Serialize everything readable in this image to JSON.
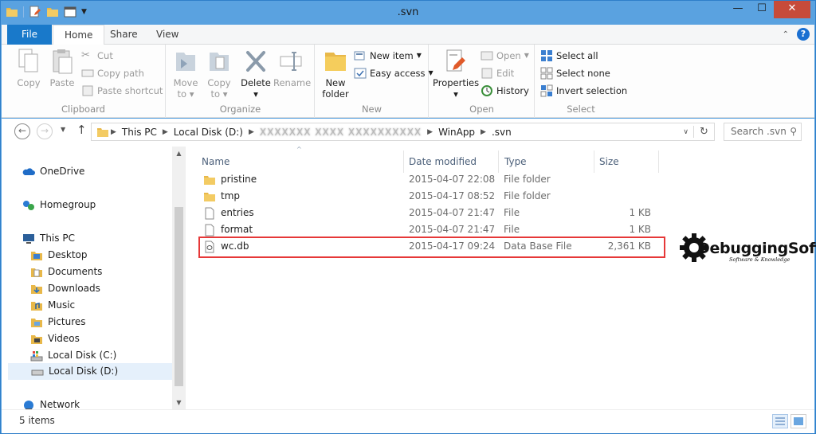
{
  "window": {
    "title": ".svn"
  },
  "titlebar": {
    "minimize": "—",
    "maximize": "☐",
    "close": "✕"
  },
  "tabs": {
    "file": "File",
    "home": "Home",
    "share": "Share",
    "view": "View"
  },
  "ribbon": {
    "clipboard": {
      "label": "Clipboard",
      "copy": "Copy",
      "paste": "Paste",
      "cut": "Cut",
      "copy_path": "Copy path",
      "paste_shortcut": "Paste shortcut"
    },
    "organize": {
      "label": "Organize",
      "move_to": "Move",
      "move_to2": "to",
      "copy_to": "Copy",
      "copy_to2": "to",
      "delete": "Delete",
      "rename": "Rename"
    },
    "new": {
      "label": "New",
      "new_folder": "New",
      "new_folder2": "folder",
      "new_item": "New item",
      "easy_access": "Easy access"
    },
    "open": {
      "label": "Open",
      "properties": "Properties",
      "open": "Open",
      "edit": "Edit",
      "history": "History"
    },
    "select": {
      "label": "Select",
      "select_all": "Select all",
      "select_none": "Select none",
      "invert": "Invert selection"
    }
  },
  "address": {
    "crumbs": [
      "This PC",
      "Local Disk (D:)"
    ],
    "obscured": "XXXXXXX XXXX XXXXXXXXXX",
    "crumbs_after": [
      "WinApp",
      ".svn"
    ]
  },
  "search": {
    "placeholder": "Search .svn"
  },
  "nav": {
    "onedrive": "OneDrive",
    "homegroup": "Homegroup",
    "thispc": "This PC",
    "desktop": "Desktop",
    "documents": "Documents",
    "downloads": "Downloads",
    "music": "Music",
    "pictures": "Pictures",
    "videos": "Videos",
    "local_c": "Local Disk (C:)",
    "local_d": "Local Disk (D:)",
    "network": "Network"
  },
  "columns": {
    "name": "Name",
    "date": "Date modified",
    "type": "Type",
    "size": "Size"
  },
  "files": [
    {
      "name": "pristine",
      "date": "2015-04-07 22:08",
      "type": "File folder",
      "size": ""
    },
    {
      "name": "tmp",
      "date": "2015-04-17 08:52",
      "type": "File folder",
      "size": ""
    },
    {
      "name": "entries",
      "date": "2015-04-07 21:47",
      "type": "File",
      "size": "1 KB"
    },
    {
      "name": "format",
      "date": "2015-04-07 21:47",
      "type": "File",
      "size": "1 KB"
    },
    {
      "name": "wc.db",
      "date": "2015-04-17 09:24",
      "type": "Data Base File",
      "size": "2,361 KB"
    }
  ],
  "status": {
    "items": "5 items"
  },
  "watermark": {
    "brand": "DebuggingSoft",
    "tagline": "Software & Knowledge"
  },
  "colors": {
    "accent": "#1979ca",
    "highlight": "#e63838",
    "folder": "#e8b84a"
  }
}
